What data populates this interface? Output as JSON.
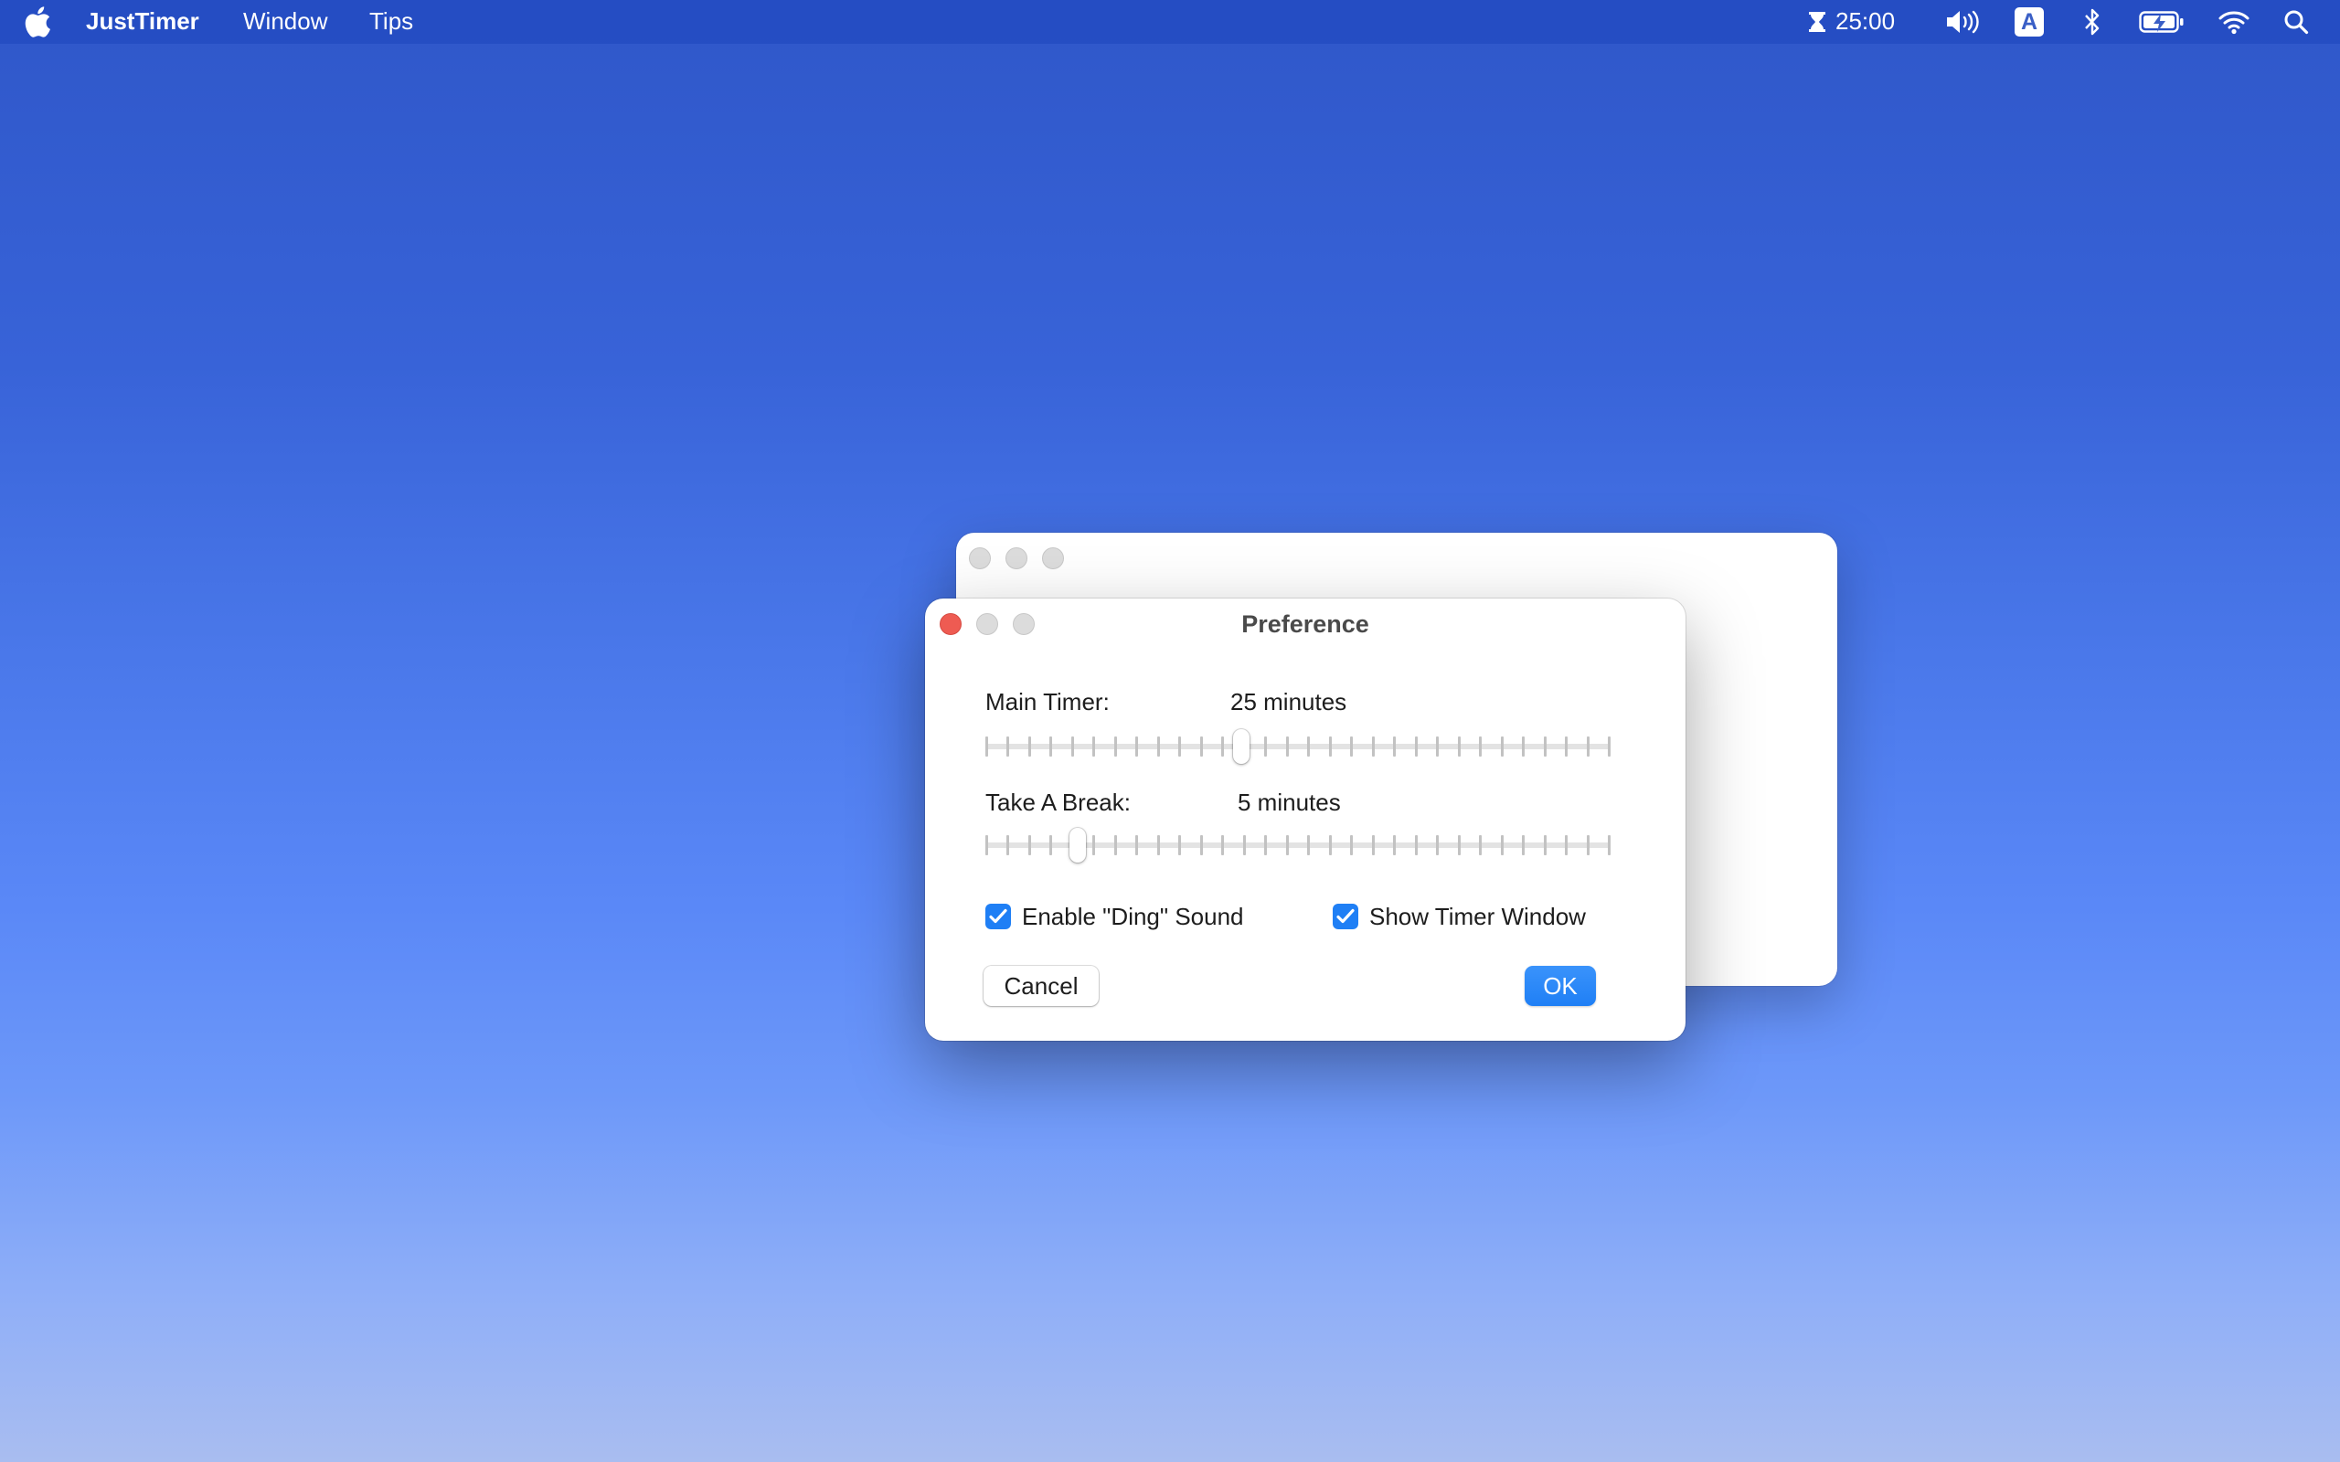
{
  "menubar": {
    "app_name": "JustTimer",
    "menus": [
      "Window",
      "Tips"
    ],
    "timer_status": "25:00",
    "input_source": "A"
  },
  "dialog": {
    "title": "Preference",
    "main_timer": {
      "label": "Main Timer:",
      "value_text": "25 minutes",
      "value": 25,
      "min": 1,
      "max": 60
    },
    "break_timer": {
      "label": "Take A Break:",
      "value_text": "5 minutes",
      "value": 5,
      "min": 1,
      "max": 30
    },
    "checkboxes": [
      {
        "label": "Enable \"Ding\" Sound",
        "checked": true
      },
      {
        "label": "Show Timer Window",
        "checked": true
      }
    ],
    "cancel_label": "Cancel",
    "ok_label": "OK"
  },
  "colors": {
    "accent": "#1f7ff5",
    "close_button": "#ee5b52"
  },
  "icons": [
    "apple-icon",
    "hourglass-icon",
    "volume-icon",
    "input-source-icon",
    "bluetooth-icon",
    "battery-icon",
    "wifi-icon",
    "spotlight-search-icon"
  ]
}
